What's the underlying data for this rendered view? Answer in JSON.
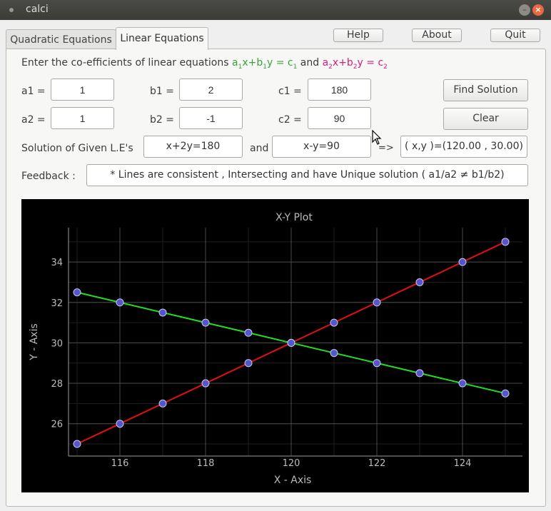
{
  "window": {
    "title": "calci"
  },
  "tabs": [
    {
      "label": "Quadratic Equations",
      "active": false
    },
    {
      "label": "Linear Equations",
      "active": true
    }
  ],
  "toolbar": {
    "help": "Help",
    "about": "About",
    "quit": "Quit"
  },
  "instruction": {
    "prefix": "Enter the co-efficients of linear equations",
    "eq1": {
      "a": "a",
      "a_sub": "1",
      "x": "x+b",
      "b_sub": "1",
      "y": "y = c",
      "c_sub": "1"
    },
    "and": "and",
    "eq2": {
      "a": "a",
      "a_sub": "2",
      "x": "x+b",
      "b_sub": "2",
      "y": "y = c",
      "c_sub": "2"
    }
  },
  "inputs": {
    "a1": {
      "label": "a1 =",
      "value": "1"
    },
    "b1": {
      "label": "b1 =",
      "value": "2"
    },
    "c1": {
      "label": "c1 =",
      "value": "180"
    },
    "a2": {
      "label": "a2 =",
      "value": "1"
    },
    "b2": {
      "label": "b2 =",
      "value": "-1"
    },
    "c2": {
      "label": "c2 =",
      "value": "90"
    }
  },
  "actions": {
    "find": "Find Solution",
    "clear": "Clear"
  },
  "solution": {
    "label": "Solution of Given L.E's",
    "eq1": "x+2y=180",
    "and": "and",
    "eq2": "x-y=90",
    "arrow": "=>",
    "result": "( x,y )=(120.00 , 30.00)"
  },
  "feedback": {
    "label": "Feedback :",
    "text": "* Lines are consistent , Intersecting and have Unique solution ( a1/a2 ≠ b1/b2)"
  },
  "chart_data": {
    "type": "line",
    "title": "X-Y Plot",
    "xlabel": "X - Axis",
    "ylabel": "Y - Axis",
    "xlim": [
      114.8,
      125.4
    ],
    "ylim": [
      24.4,
      35.7
    ],
    "xticks": [
      116,
      118,
      120,
      122,
      124
    ],
    "yticks": [
      26,
      28,
      30,
      32,
      34
    ],
    "grid": true,
    "series": [
      {
        "color": "#e01010",
        "x": [
          115,
          116,
          117,
          118,
          119,
          120,
          121,
          122,
          123,
          124,
          125
        ],
        "y": [
          25,
          26,
          27,
          28,
          29,
          30,
          31,
          32,
          33,
          34,
          35
        ]
      },
      {
        "color": "#22dd22",
        "x": [
          115,
          116,
          117,
          118,
          119,
          120,
          121,
          122,
          123,
          124,
          125
        ],
        "y": [
          32.5,
          32,
          31.5,
          31,
          30.5,
          30,
          29.5,
          29,
          28.5,
          28,
          27.5
        ]
      }
    ],
    "marker_color": "#5555cc"
  }
}
